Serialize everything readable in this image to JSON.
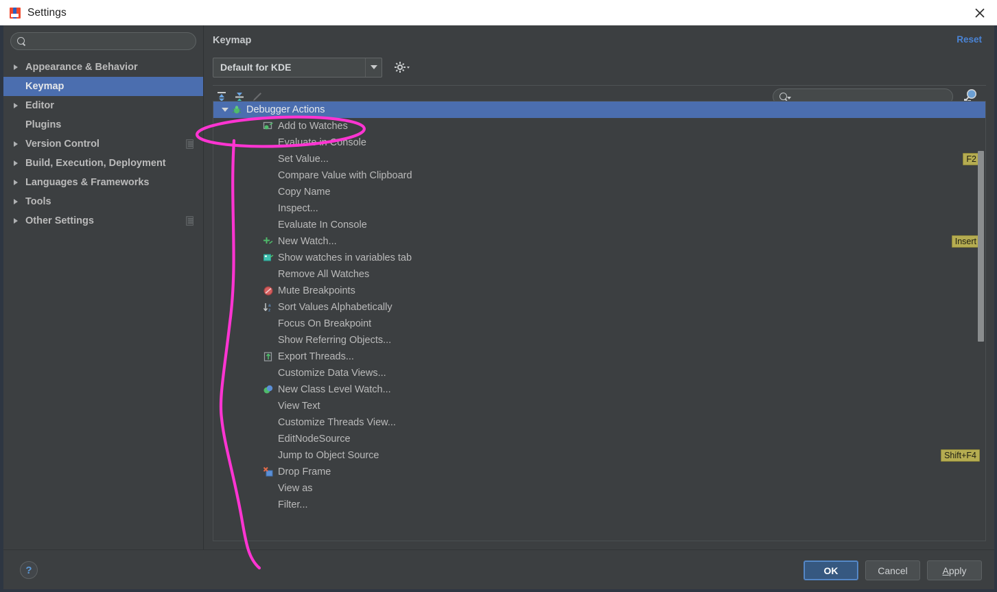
{
  "window": {
    "title": "Settings",
    "app_icon": "intellij-idea-icon",
    "close_icon": "close-icon"
  },
  "sidebar": {
    "search": {
      "value": "",
      "placeholder": "",
      "icon": "search-icon"
    },
    "items": [
      {
        "label": "Appearance & Behavior",
        "expandable": true,
        "selected": false,
        "badge": false
      },
      {
        "label": "Keymap",
        "expandable": false,
        "selected": true,
        "badge": false
      },
      {
        "label": "Editor",
        "expandable": true,
        "selected": false,
        "badge": false
      },
      {
        "label": "Plugins",
        "expandable": false,
        "selected": false,
        "badge": false
      },
      {
        "label": "Version Control",
        "expandable": true,
        "selected": false,
        "badge": true
      },
      {
        "label": "Build, Execution, Deployment",
        "expandable": true,
        "selected": false,
        "badge": false
      },
      {
        "label": "Languages & Frameworks",
        "expandable": true,
        "selected": false,
        "badge": false
      },
      {
        "label": "Tools",
        "expandable": true,
        "selected": false,
        "badge": false
      },
      {
        "label": "Other Settings",
        "expandable": true,
        "selected": false,
        "badge": true
      }
    ]
  },
  "main": {
    "title": "Keymap",
    "reset_label": "Reset",
    "keymap_select": {
      "value": "Default for KDE",
      "dropdown_icon": "chevron-down-icon"
    },
    "gear_icon": "gear-dropdown-icon",
    "toolbar": {
      "expand_all_icon": "expand-all-icon",
      "collapse_all_icon": "collapse-all-icon",
      "edit_icon": "edit-pencil-icon"
    },
    "tree_search": {
      "value": "",
      "placeholder": "",
      "icon": "search-dropdown-icon"
    },
    "find_by_shortcut_icon": "find-by-shortcut-icon",
    "tree": [
      {
        "label": "Debugger Actions",
        "level": 0,
        "selected": true,
        "icon": "debugger-bug-icon",
        "shortcut": ""
      },
      {
        "label": "Add to Watches",
        "level": 1,
        "selected": false,
        "icon": "add-to-watches-icon",
        "shortcut": ""
      },
      {
        "label": "Evaluate in Console",
        "level": 1,
        "selected": false,
        "icon": "",
        "shortcut": ""
      },
      {
        "label": "Set Value...",
        "level": 1,
        "selected": false,
        "icon": "",
        "shortcut": "F2"
      },
      {
        "label": "Compare Value with Clipboard",
        "level": 1,
        "selected": false,
        "icon": "",
        "shortcut": ""
      },
      {
        "label": "Copy Name",
        "level": 1,
        "selected": false,
        "icon": "",
        "shortcut": ""
      },
      {
        "label": "Inspect...",
        "level": 1,
        "selected": false,
        "icon": "",
        "shortcut": ""
      },
      {
        "label": "Evaluate In Console",
        "level": 1,
        "selected": false,
        "icon": "",
        "shortcut": ""
      },
      {
        "label": "New Watch...",
        "level": 1,
        "selected": false,
        "icon": "new-watch-icon",
        "shortcut": "Insert"
      },
      {
        "label": "Show watches in variables tab",
        "level": 1,
        "selected": false,
        "icon": "show-watches-icon",
        "shortcut": ""
      },
      {
        "label": "Remove All Watches",
        "level": 1,
        "selected": false,
        "icon": "",
        "shortcut": ""
      },
      {
        "label": "Mute Breakpoints",
        "level": 1,
        "selected": false,
        "icon": "mute-breakpoints-icon",
        "shortcut": ""
      },
      {
        "label": "Sort Values Alphabetically",
        "level": 1,
        "selected": false,
        "icon": "sort-alphabetically-icon",
        "shortcut": ""
      },
      {
        "label": "Focus On Breakpoint",
        "level": 1,
        "selected": false,
        "icon": "",
        "shortcut": ""
      },
      {
        "label": "Show Referring Objects...",
        "level": 1,
        "selected": false,
        "icon": "",
        "shortcut": ""
      },
      {
        "label": "Export Threads...",
        "level": 1,
        "selected": false,
        "icon": "export-threads-icon",
        "shortcut": ""
      },
      {
        "label": "Customize Data Views...",
        "level": 1,
        "selected": false,
        "icon": "",
        "shortcut": ""
      },
      {
        "label": "New Class Level Watch...",
        "level": 1,
        "selected": false,
        "icon": "class-level-watch-icon",
        "shortcut": ""
      },
      {
        "label": "View Text",
        "level": 1,
        "selected": false,
        "icon": "",
        "shortcut": ""
      },
      {
        "label": "Customize Threads View...",
        "level": 1,
        "selected": false,
        "icon": "",
        "shortcut": ""
      },
      {
        "label": "EditNodeSource",
        "level": 1,
        "selected": false,
        "icon": "",
        "shortcut": ""
      },
      {
        "label": "Jump to Object Source",
        "level": 1,
        "selected": false,
        "icon": "",
        "shortcut": "Shift+F4"
      },
      {
        "label": "Drop Frame",
        "level": 1,
        "selected": false,
        "icon": "drop-frame-icon",
        "shortcut": ""
      },
      {
        "label": "View as",
        "level": 1,
        "selected": false,
        "icon": "",
        "shortcut": ""
      },
      {
        "label": "Filter...",
        "level": 1,
        "selected": false,
        "icon": "",
        "shortcut": ""
      }
    ]
  },
  "footer": {
    "help_label": "?",
    "ok_label": "OK",
    "cancel_label": "Cancel",
    "apply_label": "Apply"
  },
  "annotation": {
    "color": "#ff34d2",
    "shape": "ellipse-with-tail",
    "target": "Debugger Actions"
  },
  "colors": {
    "background": "#3c3f41",
    "selection": "#4b6eaf",
    "titlebar": "#ffffff",
    "link": "#4a84d6",
    "shortcut_badge": "#b5ac51",
    "window_border": "#2e3642"
  }
}
